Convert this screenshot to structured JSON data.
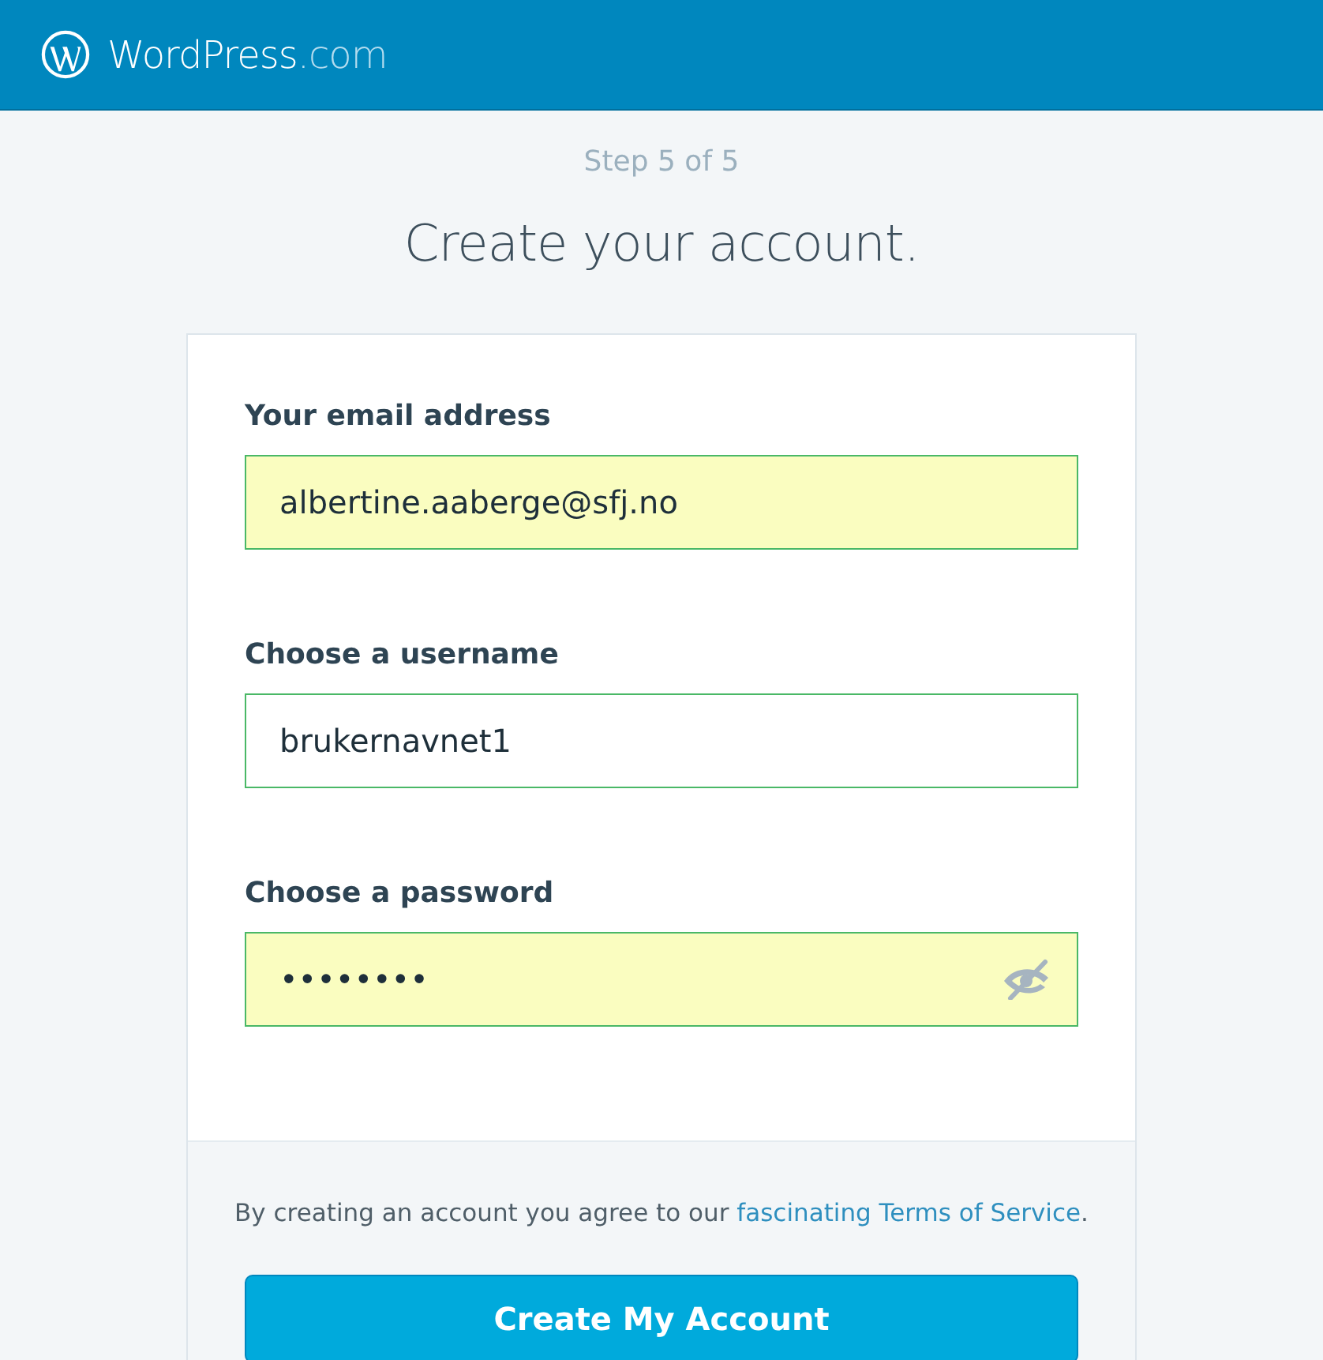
{
  "header": {
    "brand": "WordPress",
    "brand_suffix": ".com"
  },
  "step": "Step 5 of 5",
  "title": "Create your account.",
  "fields": [
    {
      "label": "Your email address",
      "value": "albertine.aaberge@sfj.no",
      "autofilled": true,
      "kind": "text"
    },
    {
      "label": "Choose a username",
      "value": "brukernavnet1",
      "autofilled": false,
      "kind": "text"
    },
    {
      "label": "Choose a password",
      "value": "••••••••",
      "autofilled": true,
      "kind": "password"
    }
  ],
  "terms": {
    "text": "By creating an account you agree to our ",
    "link": "fascinating Terms of Service",
    "end": "."
  },
  "submit": "Create My Account"
}
